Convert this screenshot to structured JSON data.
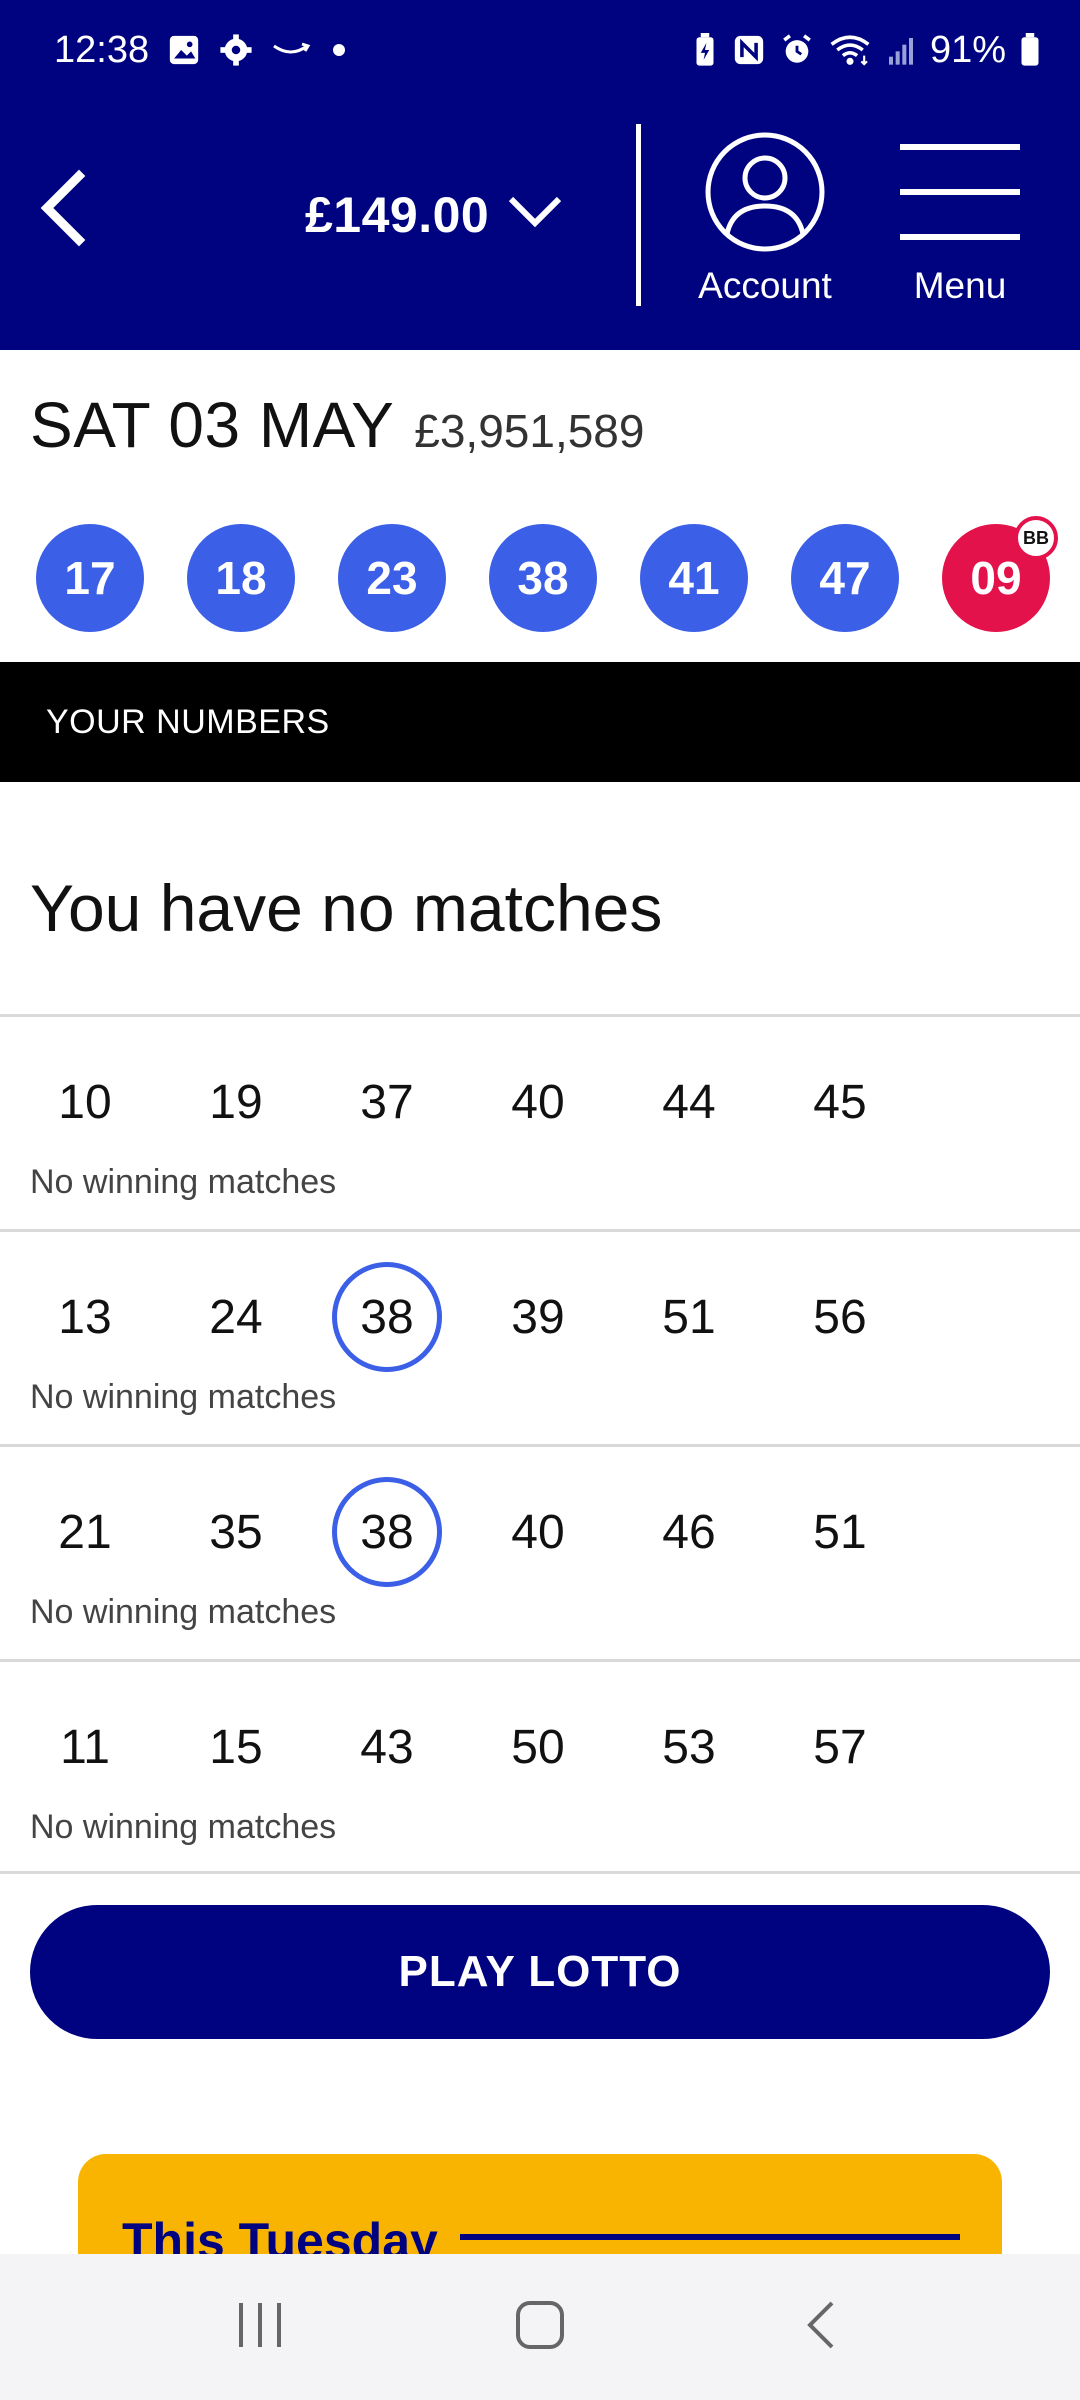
{
  "status_bar": {
    "time": "12:38",
    "battery": "91%",
    "left_icons": [
      "gallery-icon",
      "settings-icon",
      "amazon-icon",
      "dot-icon"
    ],
    "right_icons": [
      "battery-saver-icon",
      "nfc-icon",
      "alarm-icon",
      "wifi-icon",
      "signal-icon",
      "battery-icon"
    ]
  },
  "header": {
    "balance": "£149.00",
    "account_label": "Account",
    "menu_label": "Menu"
  },
  "draw": {
    "date": "SAT 03 MAY",
    "jackpot": "£3,951,589",
    "balls": [
      "17",
      "18",
      "23",
      "38",
      "41",
      "47"
    ],
    "bonus_ball": "09",
    "bonus_badge": "BB"
  },
  "your_numbers": {
    "heading": "YOUR NUMBERS",
    "summary": "You have no matches",
    "lines": [
      {
        "numbers": [
          "10",
          "19",
          "37",
          "40",
          "44",
          "45"
        ],
        "matched": [],
        "status": "No winning matches"
      },
      {
        "numbers": [
          "13",
          "24",
          "38",
          "39",
          "51",
          "56"
        ],
        "matched": [
          "38"
        ],
        "status": "No winning matches"
      },
      {
        "numbers": [
          "21",
          "35",
          "38",
          "40",
          "46",
          "51"
        ],
        "matched": [
          "38"
        ],
        "status": "No winning matches"
      },
      {
        "numbers": [
          "11",
          "15",
          "43",
          "50",
          "53",
          "57"
        ],
        "matched": [],
        "status": "No winning matches"
      }
    ]
  },
  "play_button": "PLAY LOTTO",
  "promo": {
    "title": "This Tuesday"
  },
  "colors": {
    "brand_navy": "#00037f",
    "ball_blue": "#3b5fe6",
    "bonus_red": "#e4124b",
    "promo_yellow": "#f8b400"
  }
}
